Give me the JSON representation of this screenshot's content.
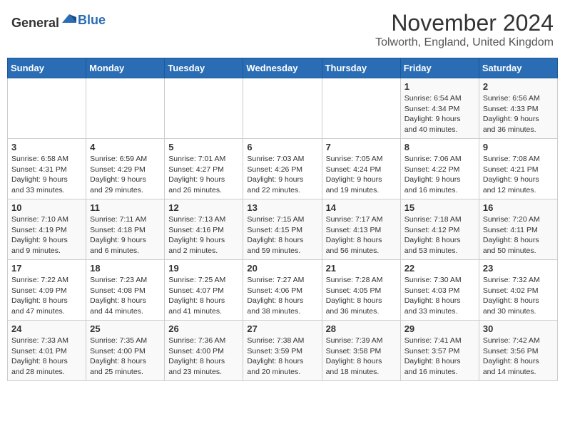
{
  "header": {
    "logo_general": "General",
    "logo_blue": "Blue",
    "month": "November 2024",
    "location": "Tolworth, England, United Kingdom"
  },
  "columns": [
    "Sunday",
    "Monday",
    "Tuesday",
    "Wednesday",
    "Thursday",
    "Friday",
    "Saturday"
  ],
  "weeks": [
    [
      {
        "day": "",
        "info": ""
      },
      {
        "day": "",
        "info": ""
      },
      {
        "day": "",
        "info": ""
      },
      {
        "day": "",
        "info": ""
      },
      {
        "day": "",
        "info": ""
      },
      {
        "day": "1",
        "info": "Sunrise: 6:54 AM\nSunset: 4:34 PM\nDaylight: 9 hours and 40 minutes."
      },
      {
        "day": "2",
        "info": "Sunrise: 6:56 AM\nSunset: 4:33 PM\nDaylight: 9 hours and 36 minutes."
      }
    ],
    [
      {
        "day": "3",
        "info": "Sunrise: 6:58 AM\nSunset: 4:31 PM\nDaylight: 9 hours and 33 minutes."
      },
      {
        "day": "4",
        "info": "Sunrise: 6:59 AM\nSunset: 4:29 PM\nDaylight: 9 hours and 29 minutes."
      },
      {
        "day": "5",
        "info": "Sunrise: 7:01 AM\nSunset: 4:27 PM\nDaylight: 9 hours and 26 minutes."
      },
      {
        "day": "6",
        "info": "Sunrise: 7:03 AM\nSunset: 4:26 PM\nDaylight: 9 hours and 22 minutes."
      },
      {
        "day": "7",
        "info": "Sunrise: 7:05 AM\nSunset: 4:24 PM\nDaylight: 9 hours and 19 minutes."
      },
      {
        "day": "8",
        "info": "Sunrise: 7:06 AM\nSunset: 4:22 PM\nDaylight: 9 hours and 16 minutes."
      },
      {
        "day": "9",
        "info": "Sunrise: 7:08 AM\nSunset: 4:21 PM\nDaylight: 9 hours and 12 minutes."
      }
    ],
    [
      {
        "day": "10",
        "info": "Sunrise: 7:10 AM\nSunset: 4:19 PM\nDaylight: 9 hours and 9 minutes."
      },
      {
        "day": "11",
        "info": "Sunrise: 7:11 AM\nSunset: 4:18 PM\nDaylight: 9 hours and 6 minutes."
      },
      {
        "day": "12",
        "info": "Sunrise: 7:13 AM\nSunset: 4:16 PM\nDaylight: 9 hours and 2 minutes."
      },
      {
        "day": "13",
        "info": "Sunrise: 7:15 AM\nSunset: 4:15 PM\nDaylight: 8 hours and 59 minutes."
      },
      {
        "day": "14",
        "info": "Sunrise: 7:17 AM\nSunset: 4:13 PM\nDaylight: 8 hours and 56 minutes."
      },
      {
        "day": "15",
        "info": "Sunrise: 7:18 AM\nSunset: 4:12 PM\nDaylight: 8 hours and 53 minutes."
      },
      {
        "day": "16",
        "info": "Sunrise: 7:20 AM\nSunset: 4:11 PM\nDaylight: 8 hours and 50 minutes."
      }
    ],
    [
      {
        "day": "17",
        "info": "Sunrise: 7:22 AM\nSunset: 4:09 PM\nDaylight: 8 hours and 47 minutes."
      },
      {
        "day": "18",
        "info": "Sunrise: 7:23 AM\nSunset: 4:08 PM\nDaylight: 8 hours and 44 minutes."
      },
      {
        "day": "19",
        "info": "Sunrise: 7:25 AM\nSunset: 4:07 PM\nDaylight: 8 hours and 41 minutes."
      },
      {
        "day": "20",
        "info": "Sunrise: 7:27 AM\nSunset: 4:06 PM\nDaylight: 8 hours and 38 minutes."
      },
      {
        "day": "21",
        "info": "Sunrise: 7:28 AM\nSunset: 4:05 PM\nDaylight: 8 hours and 36 minutes."
      },
      {
        "day": "22",
        "info": "Sunrise: 7:30 AM\nSunset: 4:03 PM\nDaylight: 8 hours and 33 minutes."
      },
      {
        "day": "23",
        "info": "Sunrise: 7:32 AM\nSunset: 4:02 PM\nDaylight: 8 hours and 30 minutes."
      }
    ],
    [
      {
        "day": "24",
        "info": "Sunrise: 7:33 AM\nSunset: 4:01 PM\nDaylight: 8 hours and 28 minutes."
      },
      {
        "day": "25",
        "info": "Sunrise: 7:35 AM\nSunset: 4:00 PM\nDaylight: 8 hours and 25 minutes."
      },
      {
        "day": "26",
        "info": "Sunrise: 7:36 AM\nSunset: 4:00 PM\nDaylight: 8 hours and 23 minutes."
      },
      {
        "day": "27",
        "info": "Sunrise: 7:38 AM\nSunset: 3:59 PM\nDaylight: 8 hours and 20 minutes."
      },
      {
        "day": "28",
        "info": "Sunrise: 7:39 AM\nSunset: 3:58 PM\nDaylight: 8 hours and 18 minutes."
      },
      {
        "day": "29",
        "info": "Sunrise: 7:41 AM\nSunset: 3:57 PM\nDaylight: 8 hours and 16 minutes."
      },
      {
        "day": "30",
        "info": "Sunrise: 7:42 AM\nSunset: 3:56 PM\nDaylight: 8 hours and 14 minutes."
      }
    ]
  ]
}
